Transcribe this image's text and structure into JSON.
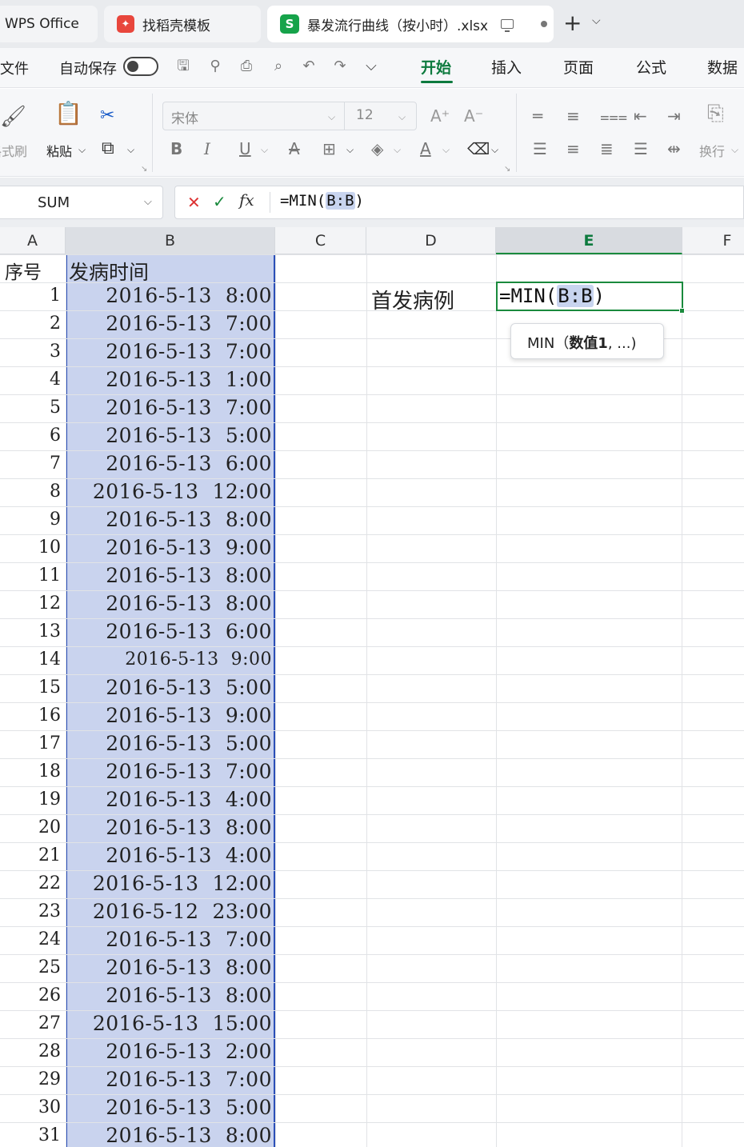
{
  "tabs": {
    "wps_label": "WPS Office",
    "template_label": "找稻壳模板",
    "file_label": "暴发流行曲线（按小时）.xlsx"
  },
  "menu": {
    "file": "文件",
    "autosave": "自动保存",
    "ribbon_tabs": [
      "开始",
      "插入",
      "页面",
      "公式",
      "数据"
    ]
  },
  "ribbon": {
    "format_painter": "格式刷",
    "paste": "粘贴",
    "font_name": "宋体",
    "font_size": "12",
    "wrap_text": "换行"
  },
  "formula_bar": {
    "name_box": "SUM",
    "formula_prefix": "=MIN(",
    "formula_ref": "B:B",
    "formula_suffix": ")"
  },
  "columns": [
    "A",
    "B",
    "C",
    "D",
    "E",
    "F"
  ],
  "headers": {
    "seq": "序号",
    "onset_time": "发病时间"
  },
  "rows": [
    {
      "seq": "1",
      "time": "2016-5-13  8:00"
    },
    {
      "seq": "2",
      "time": "2016-5-13  7:00"
    },
    {
      "seq": "3",
      "time": "2016-5-13  7:00"
    },
    {
      "seq": "4",
      "time": "2016-5-13  1:00"
    },
    {
      "seq": "5",
      "time": "2016-5-13  7:00"
    },
    {
      "seq": "6",
      "time": "2016-5-13  5:00"
    },
    {
      "seq": "7",
      "time": "2016-5-13  6:00"
    },
    {
      "seq": "8",
      "time": "2016-5-13  12:00"
    },
    {
      "seq": "9",
      "time": "2016-5-13  8:00"
    },
    {
      "seq": "10",
      "time": "2016-5-13  9:00"
    },
    {
      "seq": "11",
      "time": "2016-5-13  8:00"
    },
    {
      "seq": "12",
      "time": "2016-5-13  8:00"
    },
    {
      "seq": "13",
      "time": "2016-5-13  6:00"
    },
    {
      "seq": "14",
      "time": "2016-5-13  9:00"
    },
    {
      "seq": "15",
      "time": "2016-5-13  5:00"
    },
    {
      "seq": "16",
      "time": "2016-5-13  9:00"
    },
    {
      "seq": "17",
      "time": "2016-5-13  5:00"
    },
    {
      "seq": "18",
      "time": "2016-5-13  7:00"
    },
    {
      "seq": "19",
      "time": "2016-5-13  4:00"
    },
    {
      "seq": "20",
      "time": "2016-5-13  8:00"
    },
    {
      "seq": "21",
      "time": "2016-5-13  4:00"
    },
    {
      "seq": "22",
      "time": "2016-5-13  12:00"
    },
    {
      "seq": "23",
      "time": "2016-5-12  23:00"
    },
    {
      "seq": "24",
      "time": "2016-5-13  7:00"
    },
    {
      "seq": "25",
      "time": "2016-5-13  8:00"
    },
    {
      "seq": "26",
      "time": "2016-5-13  8:00"
    },
    {
      "seq": "27",
      "time": "2016-5-13  15:00"
    },
    {
      "seq": "28",
      "time": "2016-5-13  2:00"
    },
    {
      "seq": "29",
      "time": "2016-5-13  7:00"
    },
    {
      "seq": "30",
      "time": "2016-5-13  5:00"
    },
    {
      "seq": "31",
      "time": "2016-5-13  8:00"
    }
  ],
  "first_case": {
    "label": "首发病例",
    "cell_prefix": "=MIN(",
    "cell_ref": "B:B",
    "cell_suffix": ")"
  },
  "tooltip": {
    "func": "MIN",
    "args_prefix": "（",
    "arg_bold": "数值1",
    "args_rest": ", ...)"
  },
  "colors": {
    "accent_green": "#0d7a3e",
    "selection_fill": "#c9d3ee",
    "selection_border": "#2b4fb8",
    "cancel_red": "#d33333"
  }
}
